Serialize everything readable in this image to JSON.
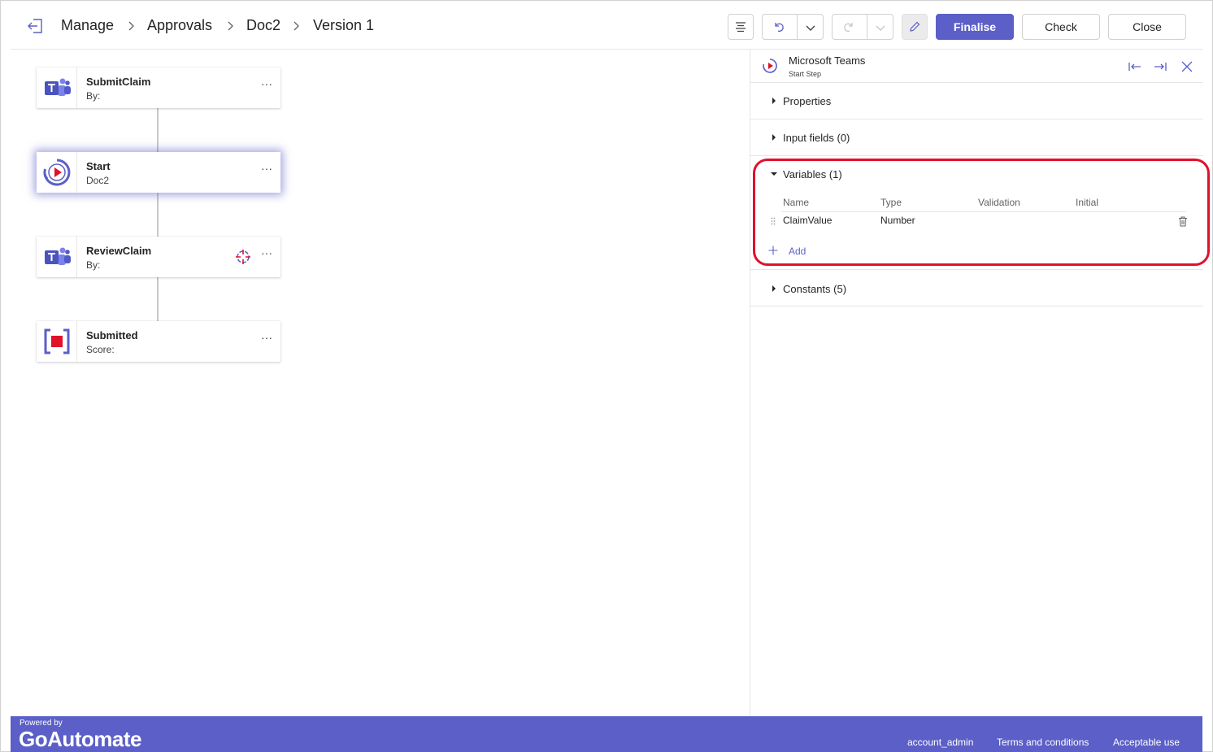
{
  "breadcrumb": [
    "Manage",
    "Approvals",
    "Doc2",
    "Version 1"
  ],
  "toolbar": {
    "finalise_label": "Finalise",
    "check_label": "Check",
    "close_label": "Close"
  },
  "nodes": [
    {
      "title": "SubmitClaim",
      "subtitle": "By:",
      "icon": "teams-icon"
    },
    {
      "title": "Start",
      "subtitle": "Doc2",
      "icon": "start-play-icon"
    },
    {
      "title": "ReviewClaim",
      "subtitle": "By:",
      "icon": "teams-icon"
    },
    {
      "title": "Submitted",
      "subtitle": "Score:",
      "icon": "end-stop-icon"
    }
  ],
  "more_glyph": "···",
  "panel": {
    "title": "Microsoft Teams",
    "subtitle": "Start Step",
    "sections": {
      "properties": "Properties",
      "input_fields": "Input fields (0)",
      "variables": "Variables (1)",
      "constants": "Constants (5)"
    },
    "variables_table": {
      "columns": [
        "Name",
        "Type",
        "Validation",
        "Initial"
      ],
      "rows": [
        {
          "name": "ClaimValue",
          "type": "Number",
          "validation": "",
          "initial": ""
        }
      ]
    },
    "add_label": "Add"
  },
  "footer": {
    "powered_by": "Powered by",
    "logo": "GoAutomate",
    "links": [
      "account_admin",
      "Terms and conditions",
      "Acceptable use"
    ]
  },
  "colors": {
    "accent": "#5b5fc7",
    "highlight": "#e0112b",
    "start_red": "#e0112b"
  }
}
